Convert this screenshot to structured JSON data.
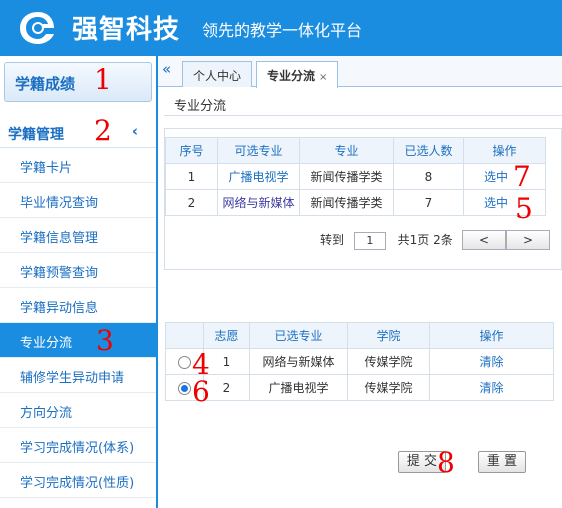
{
  "header": {
    "brand": "强智科技",
    "slogan": "领先的教学一体化平台"
  },
  "sidebar": {
    "top_button": "学籍成绩",
    "section": "学籍管理",
    "items": [
      "学籍卡片",
      "毕业情况查询",
      "学籍信息管理",
      "学籍预警查询",
      "学籍异动信息",
      "专业分流",
      "辅修学生异动申请",
      "方向分流",
      "学习完成情况(体系)",
      "学习完成情况(性质)"
    ],
    "active_index": 5
  },
  "tabs": {
    "collapse": "«",
    "items": [
      "个人中心",
      "专业分流"
    ],
    "close": "×"
  },
  "breadcrumb": "专业分流",
  "majors_table": {
    "headers": [
      "序号",
      "可选专业",
      "专业",
      "已选人数",
      "操作"
    ],
    "rows": [
      {
        "no": "1",
        "option": "广播电视学",
        "major": "新闻传播学类",
        "count": "8",
        "action": "选中"
      },
      {
        "no": "2",
        "option": "网络与新媒体",
        "major": "新闻传播学类",
        "count": "7",
        "action": "选中"
      }
    ]
  },
  "pager": {
    "goto": "转到",
    "page": "1",
    "summary": "共1页 2条",
    "prev": "<",
    "next": ">"
  },
  "choice_table": {
    "headers": [
      "志愿",
      "已选专业",
      "学院",
      "操作"
    ],
    "rows": [
      {
        "no": "1",
        "major": "网络与新媒体",
        "college": "传媒学院",
        "action": "清除",
        "selected": false
      },
      {
        "no": "2",
        "major": "广播电视学",
        "college": "传媒学院",
        "action": "清除",
        "selected": true
      }
    ]
  },
  "buttons": {
    "submit": "提 交",
    "reset": "重 置"
  },
  "markers": [
    "1",
    "2",
    "3",
    "4",
    "5",
    "6",
    "7",
    "8"
  ],
  "colors": {
    "primary": "#1b8de0",
    "link": "#1b6fc2",
    "marker": "#ee0000"
  }
}
